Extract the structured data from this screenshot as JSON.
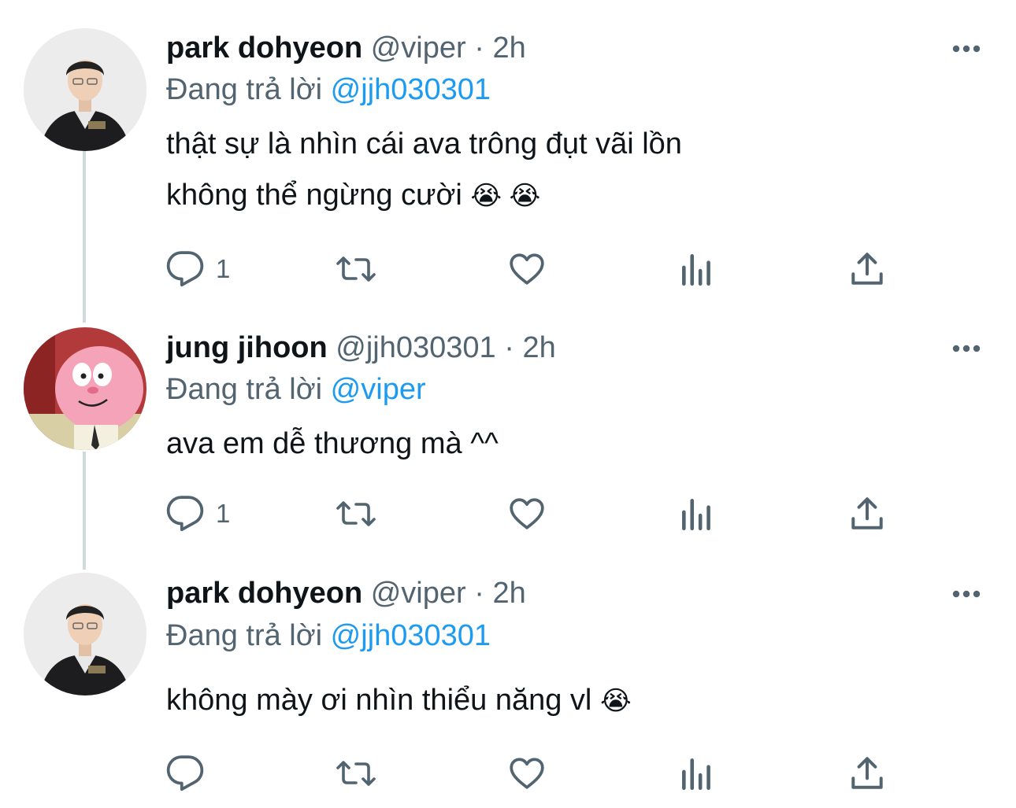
{
  "tweets": [
    {
      "display_name": "park dohyeon",
      "handle": "@viper",
      "separator": " · ",
      "time": "2h",
      "reply_prefix": "Đang trả lời ",
      "reply_to": "@jjh030301",
      "body_lines": [
        "thật sự là nhìn cái ava trông đụt vãi lồn",
        "không thể ngừng cười"
      ],
      "body_emoji": "😭 😭",
      "reply_count": "1",
      "avatar_icon": "player-photo-avatar"
    },
    {
      "display_name": "jung jihoon",
      "handle": "@jjh030301",
      "separator": " · ",
      "time": "2h",
      "reply_prefix": "Đang trả lời ",
      "reply_to": "@viper",
      "body_lines": [
        "ava em dễ thương mà ^^"
      ],
      "reply_count": "1",
      "avatar_icon": "cartoon-cat-avatar"
    },
    {
      "display_name": "park dohyeon",
      "handle": "@viper",
      "separator": " · ",
      "time": "2h",
      "reply_prefix": "Đang trả lời ",
      "reply_to": "@jjh030301",
      "body_lines": [
        "không mày ơi nhìn thiểu năng vl"
      ],
      "body_emoji": "😭",
      "reply_count": "",
      "avatar_icon": "player-photo-avatar"
    }
  ],
  "icons": {
    "more": "more-horizontal-icon",
    "reply": "reply-bubble-icon",
    "retweet": "retweet-icon",
    "like": "heart-icon",
    "views": "analytics-bars-icon",
    "share": "share-upload-icon"
  },
  "colors": {
    "text": "#0f1419",
    "secondary": "#536471",
    "accent": "#1d9bf0",
    "thread_line": "#cfd9de"
  }
}
